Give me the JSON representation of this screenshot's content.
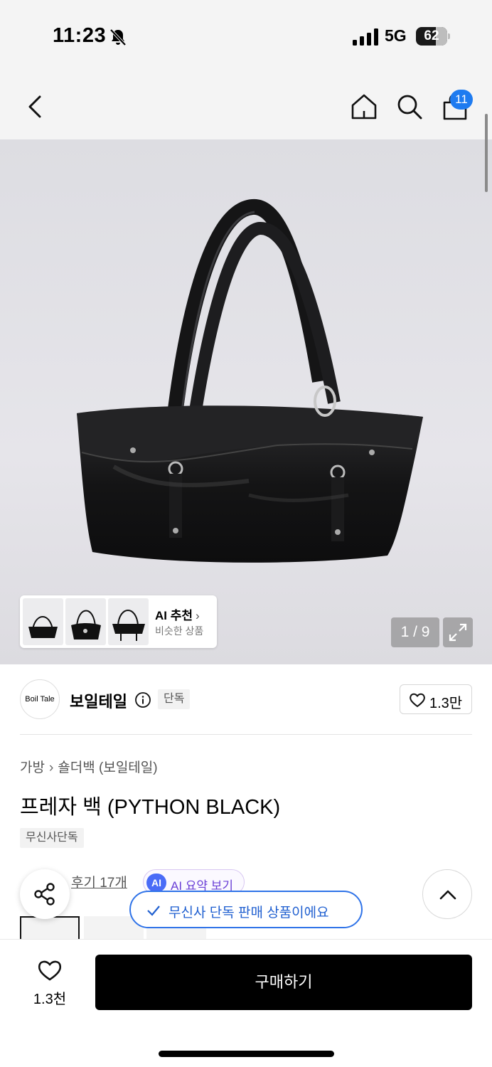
{
  "status_bar": {
    "time": "11:23",
    "network": "5G",
    "battery": "62"
  },
  "nav": {
    "cart_count": "11"
  },
  "gallery": {
    "ai_title": "AI 추천",
    "ai_chevron": "›",
    "ai_subtitle": "비슷한 상품",
    "counter": "1 / 9"
  },
  "brand": {
    "logo_text": "Boil Tale",
    "name": "보일테일",
    "tag": "단독",
    "likes": "1.3만"
  },
  "breadcrumb": {
    "category": "가방",
    "separator": "›",
    "subcategory": "숄더백 (보일테일)"
  },
  "product": {
    "title": "프레자 백 (PYTHON BLACK)",
    "tag": "무신사단독",
    "reviews": "후기 17개",
    "ai_badge": "AI",
    "ai_summary": "AI 요약 보기"
  },
  "toast": {
    "exclusive": "무신사 단독 판매 상품이에요"
  },
  "bottom_bar": {
    "wish_count": "1.3천",
    "buy_label": "구매하기"
  }
}
